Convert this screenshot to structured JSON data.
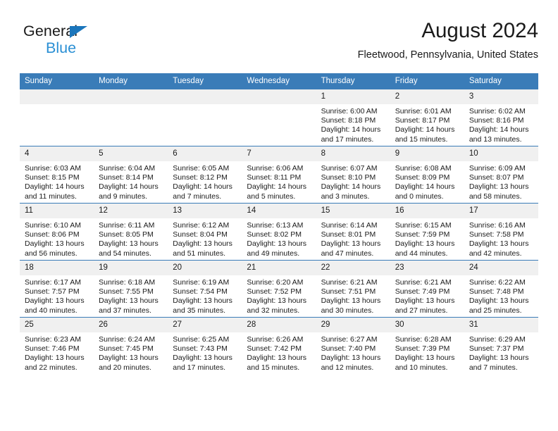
{
  "brand": {
    "name_part1": "General",
    "name_part2": "Blue",
    "flag_icon": "blue-triangle-flag-icon"
  },
  "header": {
    "month_title": "August 2024",
    "location": "Fleetwood, Pennsylvania, United States"
  },
  "colors": {
    "header_blue": "#3a7cb8",
    "brand_blue": "#2a8fd4",
    "daynum_band": "#f0f0f0",
    "text": "#1a1a1a"
  },
  "weekdays": [
    "Sunday",
    "Monday",
    "Tuesday",
    "Wednesday",
    "Thursday",
    "Friday",
    "Saturday"
  ],
  "weeks": [
    [
      {
        "day": "",
        "empty": true
      },
      {
        "day": "",
        "empty": true
      },
      {
        "day": "",
        "empty": true
      },
      {
        "day": "",
        "empty": true
      },
      {
        "day": "1",
        "sunrise": "Sunrise: 6:00 AM",
        "sunset": "Sunset: 8:18 PM",
        "daylight_line1": "Daylight: 14 hours",
        "daylight_line2": "and 17 minutes."
      },
      {
        "day": "2",
        "sunrise": "Sunrise: 6:01 AM",
        "sunset": "Sunset: 8:17 PM",
        "daylight_line1": "Daylight: 14 hours",
        "daylight_line2": "and 15 minutes."
      },
      {
        "day": "3",
        "sunrise": "Sunrise: 6:02 AM",
        "sunset": "Sunset: 8:16 PM",
        "daylight_line1": "Daylight: 14 hours",
        "daylight_line2": "and 13 minutes."
      }
    ],
    [
      {
        "day": "4",
        "sunrise": "Sunrise: 6:03 AM",
        "sunset": "Sunset: 8:15 PM",
        "daylight_line1": "Daylight: 14 hours",
        "daylight_line2": "and 11 minutes."
      },
      {
        "day": "5",
        "sunrise": "Sunrise: 6:04 AM",
        "sunset": "Sunset: 8:14 PM",
        "daylight_line1": "Daylight: 14 hours",
        "daylight_line2": "and 9 minutes."
      },
      {
        "day": "6",
        "sunrise": "Sunrise: 6:05 AM",
        "sunset": "Sunset: 8:12 PM",
        "daylight_line1": "Daylight: 14 hours",
        "daylight_line2": "and 7 minutes."
      },
      {
        "day": "7",
        "sunrise": "Sunrise: 6:06 AM",
        "sunset": "Sunset: 8:11 PM",
        "daylight_line1": "Daylight: 14 hours",
        "daylight_line2": "and 5 minutes."
      },
      {
        "day": "8",
        "sunrise": "Sunrise: 6:07 AM",
        "sunset": "Sunset: 8:10 PM",
        "daylight_line1": "Daylight: 14 hours",
        "daylight_line2": "and 3 minutes."
      },
      {
        "day": "9",
        "sunrise": "Sunrise: 6:08 AM",
        "sunset": "Sunset: 8:09 PM",
        "daylight_line1": "Daylight: 14 hours",
        "daylight_line2": "and 0 minutes."
      },
      {
        "day": "10",
        "sunrise": "Sunrise: 6:09 AM",
        "sunset": "Sunset: 8:07 PM",
        "daylight_line1": "Daylight: 13 hours",
        "daylight_line2": "and 58 minutes."
      }
    ],
    [
      {
        "day": "11",
        "sunrise": "Sunrise: 6:10 AM",
        "sunset": "Sunset: 8:06 PM",
        "daylight_line1": "Daylight: 13 hours",
        "daylight_line2": "and 56 minutes."
      },
      {
        "day": "12",
        "sunrise": "Sunrise: 6:11 AM",
        "sunset": "Sunset: 8:05 PM",
        "daylight_line1": "Daylight: 13 hours",
        "daylight_line2": "and 54 minutes."
      },
      {
        "day": "13",
        "sunrise": "Sunrise: 6:12 AM",
        "sunset": "Sunset: 8:04 PM",
        "daylight_line1": "Daylight: 13 hours",
        "daylight_line2": "and 51 minutes."
      },
      {
        "day": "14",
        "sunrise": "Sunrise: 6:13 AM",
        "sunset": "Sunset: 8:02 PM",
        "daylight_line1": "Daylight: 13 hours",
        "daylight_line2": "and 49 minutes."
      },
      {
        "day": "15",
        "sunrise": "Sunrise: 6:14 AM",
        "sunset": "Sunset: 8:01 PM",
        "daylight_line1": "Daylight: 13 hours",
        "daylight_line2": "and 47 minutes."
      },
      {
        "day": "16",
        "sunrise": "Sunrise: 6:15 AM",
        "sunset": "Sunset: 7:59 PM",
        "daylight_line1": "Daylight: 13 hours",
        "daylight_line2": "and 44 minutes."
      },
      {
        "day": "17",
        "sunrise": "Sunrise: 6:16 AM",
        "sunset": "Sunset: 7:58 PM",
        "daylight_line1": "Daylight: 13 hours",
        "daylight_line2": "and 42 minutes."
      }
    ],
    [
      {
        "day": "18",
        "sunrise": "Sunrise: 6:17 AM",
        "sunset": "Sunset: 7:57 PM",
        "daylight_line1": "Daylight: 13 hours",
        "daylight_line2": "and 40 minutes."
      },
      {
        "day": "19",
        "sunrise": "Sunrise: 6:18 AM",
        "sunset": "Sunset: 7:55 PM",
        "daylight_line1": "Daylight: 13 hours",
        "daylight_line2": "and 37 minutes."
      },
      {
        "day": "20",
        "sunrise": "Sunrise: 6:19 AM",
        "sunset": "Sunset: 7:54 PM",
        "daylight_line1": "Daylight: 13 hours",
        "daylight_line2": "and 35 minutes."
      },
      {
        "day": "21",
        "sunrise": "Sunrise: 6:20 AM",
        "sunset": "Sunset: 7:52 PM",
        "daylight_line1": "Daylight: 13 hours",
        "daylight_line2": "and 32 minutes."
      },
      {
        "day": "22",
        "sunrise": "Sunrise: 6:21 AM",
        "sunset": "Sunset: 7:51 PM",
        "daylight_line1": "Daylight: 13 hours",
        "daylight_line2": "and 30 minutes."
      },
      {
        "day": "23",
        "sunrise": "Sunrise: 6:21 AM",
        "sunset": "Sunset: 7:49 PM",
        "daylight_line1": "Daylight: 13 hours",
        "daylight_line2": "and 27 minutes."
      },
      {
        "day": "24",
        "sunrise": "Sunrise: 6:22 AM",
        "sunset": "Sunset: 7:48 PM",
        "daylight_line1": "Daylight: 13 hours",
        "daylight_line2": "and 25 minutes."
      }
    ],
    [
      {
        "day": "25",
        "sunrise": "Sunrise: 6:23 AM",
        "sunset": "Sunset: 7:46 PM",
        "daylight_line1": "Daylight: 13 hours",
        "daylight_line2": "and 22 minutes."
      },
      {
        "day": "26",
        "sunrise": "Sunrise: 6:24 AM",
        "sunset": "Sunset: 7:45 PM",
        "daylight_line1": "Daylight: 13 hours",
        "daylight_line2": "and 20 minutes."
      },
      {
        "day": "27",
        "sunrise": "Sunrise: 6:25 AM",
        "sunset": "Sunset: 7:43 PM",
        "daylight_line1": "Daylight: 13 hours",
        "daylight_line2": "and 17 minutes."
      },
      {
        "day": "28",
        "sunrise": "Sunrise: 6:26 AM",
        "sunset": "Sunset: 7:42 PM",
        "daylight_line1": "Daylight: 13 hours",
        "daylight_line2": "and 15 minutes."
      },
      {
        "day": "29",
        "sunrise": "Sunrise: 6:27 AM",
        "sunset": "Sunset: 7:40 PM",
        "daylight_line1": "Daylight: 13 hours",
        "daylight_line2": "and 12 minutes."
      },
      {
        "day": "30",
        "sunrise": "Sunrise: 6:28 AM",
        "sunset": "Sunset: 7:39 PM",
        "daylight_line1": "Daylight: 13 hours",
        "daylight_line2": "and 10 minutes."
      },
      {
        "day": "31",
        "sunrise": "Sunrise: 6:29 AM",
        "sunset": "Sunset: 7:37 PM",
        "daylight_line1": "Daylight: 13 hours",
        "daylight_line2": "and 7 minutes."
      }
    ]
  ]
}
